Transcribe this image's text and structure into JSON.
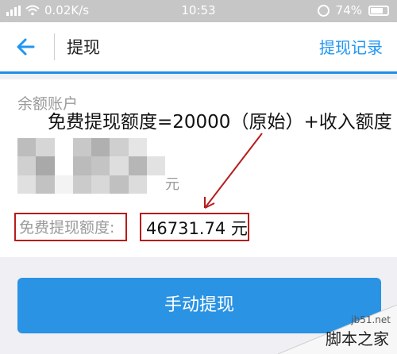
{
  "status_bar": {
    "network_speed": "0.02K/s",
    "time": "10:53",
    "battery": "74%"
  },
  "nav": {
    "title": "提现",
    "right_link": "提现记录"
  },
  "account": {
    "section_label": "余额账户",
    "balance_unit": "元",
    "free_quota_label": "免费提现额度:",
    "free_quota_value": "46731.74 元"
  },
  "annotation": {
    "text": "免费提现额度=20000（原始）+收入额度"
  },
  "action": {
    "button_label": "手动提现"
  },
  "watermark": {
    "site": "jb51.net",
    "brand": "脚本之家"
  },
  "colors": {
    "accent": "#2196f3",
    "button": "#2a93e4",
    "highlight": "#b71c1c"
  }
}
